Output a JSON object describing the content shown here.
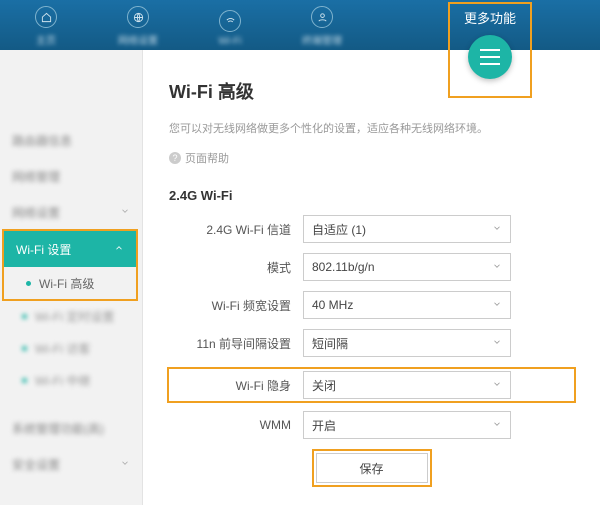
{
  "nav": [
    "主页",
    "网络设置",
    "Wi-Fi",
    "终端管理"
  ],
  "nav_more": "更多功能",
  "sidebar": {
    "items": [
      "路由器信息",
      "网络管理",
      "网络设置",
      "系统管理功能(高)",
      "安全设置"
    ],
    "active": "Wi-Fi 设置",
    "sub_active": "Wi-Fi 高级",
    "subs": [
      "Wi-Fi 定时设置",
      "Wi-Fi 访客",
      "Wi-Fi 中继"
    ]
  },
  "content": {
    "title": "Wi-Fi 高级",
    "desc": "您可以对无线网络做更多个性化的设置，适应各种无线网络环境。",
    "help": "页面帮助",
    "section": "2.4G Wi-Fi",
    "fields": {
      "channel": {
        "label": "2.4G Wi-Fi 信道",
        "value": "自适应 (1)"
      },
      "mode": {
        "label": "模式",
        "value": "802.11b/g/n"
      },
      "bandwidth": {
        "label": "Wi-Fi 频宽设置",
        "value": "40 MHz"
      },
      "guard": {
        "label": "11n 前导间隔设置",
        "value": "短间隔"
      },
      "hidden": {
        "label": "Wi-Fi 隐身",
        "value": "关闭"
      },
      "wmm": {
        "label": "WMM",
        "value": "开启"
      }
    },
    "save": "保存"
  },
  "colors": {
    "accent": "#1db5a6",
    "highlight": "#f0a020",
    "header": "#1a6fa5"
  }
}
